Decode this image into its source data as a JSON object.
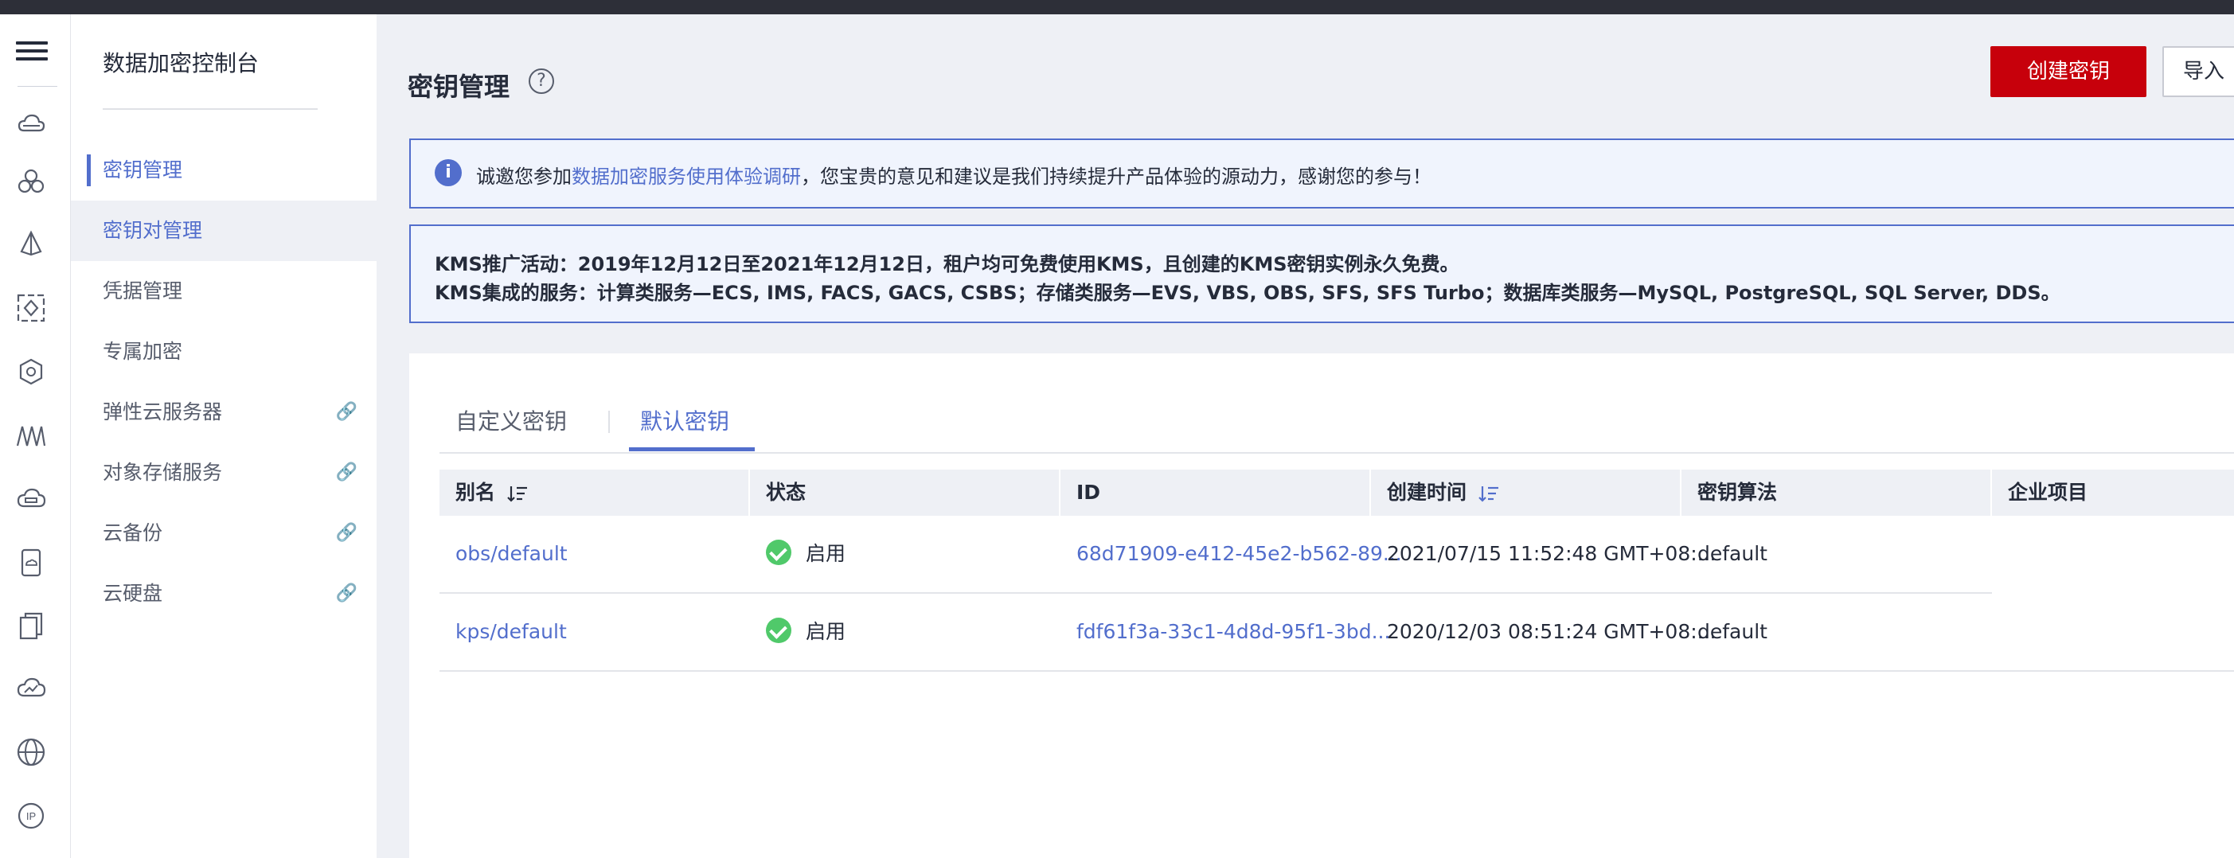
{
  "sidebar": {
    "title": "数据加密控制台",
    "items": [
      {
        "label": "密钥管理",
        "state": "active"
      },
      {
        "label": "密钥对管理",
        "state": "hover"
      },
      {
        "label": "凭据管理",
        "state": ""
      },
      {
        "label": "专属加密",
        "state": ""
      },
      {
        "label": "弹性云服务器",
        "state": "",
        "external": true
      },
      {
        "label": "对象存储服务",
        "state": "",
        "external": true
      },
      {
        "label": "云备份",
        "state": "",
        "external": true
      },
      {
        "label": "云硬盘",
        "state": "",
        "external": true
      }
    ],
    "link_icon": "🔗"
  },
  "rail": {
    "icons": [
      "menu-icon",
      "cloud-icon",
      "cluster-icon",
      "deploy-icon",
      "diamond-icon",
      "cube-gear-icon",
      "network-wave-icon",
      "cloud-storage-icon",
      "phone-cloud-icon",
      "doc-stack-icon",
      "cloud-chart-icon",
      "globe-icon",
      "ip-icon"
    ]
  },
  "header": {
    "title": "密钥管理",
    "help_icon": "?",
    "create_button": "创建密钥",
    "import_button": "导入"
  },
  "notice1": {
    "icon": "i",
    "prefix": "诚邀您参加",
    "link": "数据加密服务使用体验调研",
    "suffix": "，您宝贵的意见和建议是我们持续提升产品体验的源动力，感谢您的参与！"
  },
  "notice2": {
    "line1": "KMS推广活动：2019年12月12日至2021年12月12日，租户均可免费使用KMS，且创建的KMS密钥实例永久免费。",
    "line2": "KMS集成的服务：计算类服务—ECS, IMS, FACS, GACS, CSBS；存储类服务—EVS, VBS, OBS, SFS, SFS Turbo；数据库类服务—MySQL, PostgreSQL, SQL Server, DDS。"
  },
  "tabs": [
    {
      "label": "自定义密钥",
      "active": false
    },
    {
      "label": "默认密钥",
      "active": true
    }
  ],
  "table": {
    "headers": [
      "别名",
      "状态",
      "ID",
      "创建时间",
      "密钥算法",
      "企业项目"
    ],
    "rows": [
      {
        "alias": "obs/default",
        "status": "启用",
        "id": "68d71909-e412-45e2-b562-89...",
        "created": "2021/07/15 11:52:48 GMT+08:...",
        "algorithm": "default",
        "project": ""
      },
      {
        "alias": "kps/default",
        "status": "启用",
        "id": "fdf61f3a-33c1-4d8d-95f1-3bd...",
        "created": "2020/12/03 08:51:24 GMT+08:...",
        "algorithm": "default",
        "project": ""
      }
    ]
  },
  "colors": {
    "accent": "#526ecc",
    "primary_button": "#c7000b",
    "status_ok": "#50c96a",
    "topbar": "#2d2f38"
  }
}
